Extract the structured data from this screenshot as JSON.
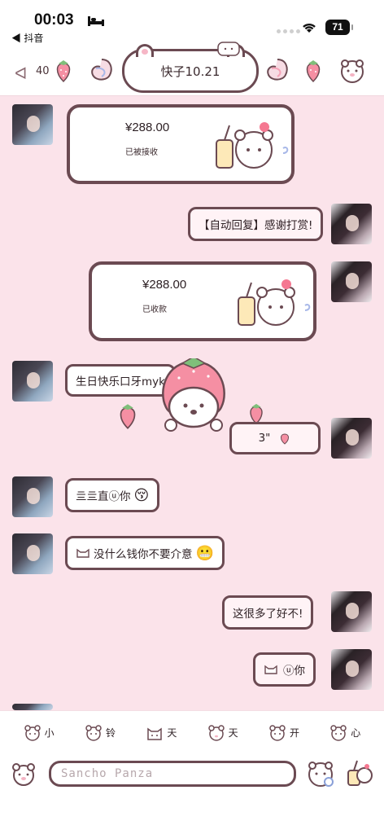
{
  "status_bar": {
    "time": "00:03",
    "back_app": "◀ 抖音",
    "battery": "71"
  },
  "header": {
    "title": "快子10.21",
    "unread_count": "40"
  },
  "messages": {
    "m1": {
      "amount": "¥288.00",
      "status": "已被接收"
    },
    "m2": {
      "text": "【自动回复】感谢打赏!"
    },
    "m3": {
      "amount": "¥288.00",
      "status": "已收款"
    },
    "m4": {
      "text": "生日快乐口牙myk"
    },
    "m5": {
      "text": "3\""
    },
    "m6": {
      "text": "亖亖直ⓤ你"
    },
    "m7": {
      "text": "没什么钱你不要介意"
    },
    "m8": {
      "text": "这很多了好不!"
    },
    "m9": {
      "text": "ⓤ你"
    }
  },
  "stickers": [
    {
      "label": "小"
    },
    {
      "label": "铃"
    },
    {
      "label": "天"
    },
    {
      "label": "天"
    },
    {
      "label": "开"
    },
    {
      "label": "心"
    }
  ],
  "input": {
    "placeholder": "Sancho Panza"
  }
}
